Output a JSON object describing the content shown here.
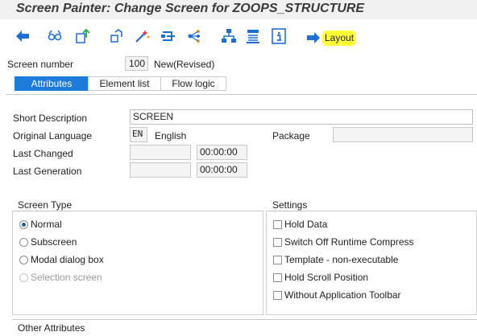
{
  "title": "Screen Painter: Change Screen for ZOOPS_STRUCTURE",
  "toolbar": {
    "icons": [
      "back-arrow-icon",
      "glasses-display-icon",
      "copy-object-icon",
      "check-icon",
      "activate-wand-icon",
      "where-used-icon",
      "hierarchy-icon",
      "tree-structure-icon",
      "list-object-icon",
      "info-icon"
    ],
    "layout_label": "Layout",
    "highlight_color": "#ffff35",
    "accent_color": "#1d7bdc"
  },
  "screen_number": {
    "label": "Screen number",
    "value": "100",
    "status": "New(Revised)"
  },
  "tabs": [
    {
      "label": "Attributes",
      "active": true
    },
    {
      "label": "Element list",
      "active": false
    },
    {
      "label": "Flow logic",
      "active": false
    }
  ],
  "fields": {
    "short_description": {
      "label": "Short Description",
      "value": "SCREEN"
    },
    "original_language": {
      "label": "Original Language",
      "code": "EN",
      "name": "English"
    },
    "package": {
      "label": "Package",
      "value": ""
    },
    "last_changed": {
      "label": "Last Changed",
      "date": "",
      "time": "00:00:00"
    },
    "last_generation": {
      "label": "Last Generation",
      "date": "",
      "time": "00:00:00"
    }
  },
  "screen_type": {
    "title": "Screen Type",
    "options": [
      {
        "label": "Normal",
        "selected": true,
        "disabled": false
      },
      {
        "label": "Subscreen",
        "selected": false,
        "disabled": false
      },
      {
        "label": "Modal dialog box",
        "selected": false,
        "disabled": false
      },
      {
        "label": "Selection screen",
        "selected": false,
        "disabled": true
      }
    ]
  },
  "settings": {
    "title": "Settings",
    "options": [
      {
        "label": "Hold Data",
        "checked": false
      },
      {
        "label": "Switch Off Runtime Compress",
        "checked": false
      },
      {
        "label": "Template - non-executable",
        "checked": false
      },
      {
        "label": "Hold Scroll Position",
        "checked": false
      },
      {
        "label": "Without Application Toolbar",
        "checked": false
      }
    ]
  },
  "other_attributes": {
    "title": "Other Attributes"
  }
}
